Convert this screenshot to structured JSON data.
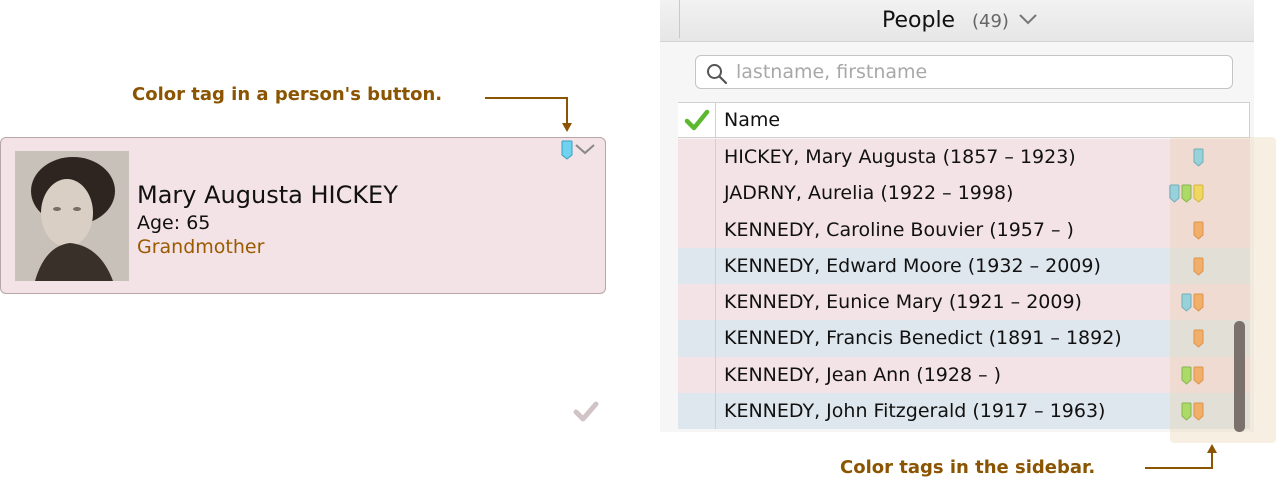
{
  "annotations": {
    "card_label": "Color tag in a person's button.",
    "sidebar_label": "Color tags in the sidebar."
  },
  "person_card": {
    "name": "Mary Augusta HICKEY",
    "age": "Age: 65",
    "relationship": "Grandmother",
    "tags": [
      "cyan"
    ]
  },
  "sidebar": {
    "title": "People",
    "count": "(49)",
    "search": {
      "placeholder": "lastname, firstname",
      "value": ""
    },
    "column_header": "Name",
    "rows": [
      {
        "name": "HICKEY, Mary Augusta (1857 – 1923)",
        "bg": "pink",
        "tags": [
          "cyan"
        ]
      },
      {
        "name": "JADRNY, Aurelia (1922 – 1998)",
        "bg": "pink",
        "tags": [
          "cyan",
          "green",
          "yellow"
        ]
      },
      {
        "name": "KENNEDY, Caroline Bouvier (1957 – )",
        "bg": "pink",
        "tags": [
          "orange"
        ]
      },
      {
        "name": "KENNEDY, Edward Moore (1932 – 2009)",
        "bg": "blue",
        "tags": [
          "orange"
        ]
      },
      {
        "name": "KENNEDY, Eunice Mary (1921 – 2009)",
        "bg": "pink",
        "tags": [
          "cyan",
          "orange"
        ]
      },
      {
        "name": "KENNEDY, Francis Benedict (1891 – 1892)",
        "bg": "blue",
        "tags": [
          "orange"
        ]
      },
      {
        "name": "KENNEDY, Jean Ann (1928 – )",
        "bg": "pink",
        "tags": [
          "green",
          "orange"
        ]
      },
      {
        "name": "KENNEDY, John Fitzgerald (1917 – 1963)",
        "bg": "blue",
        "tags": [
          "green",
          "orange"
        ]
      }
    ]
  },
  "colors": {
    "annotation": "#8a5400",
    "cyan": "#6fd3f0",
    "green": "#8ee046",
    "yellow": "#f4dc3c",
    "orange": "#f5a04a",
    "checkmark": "#5cb82e",
    "row_pink": "#f3e2e6",
    "row_blue": "#dfe7ee"
  }
}
